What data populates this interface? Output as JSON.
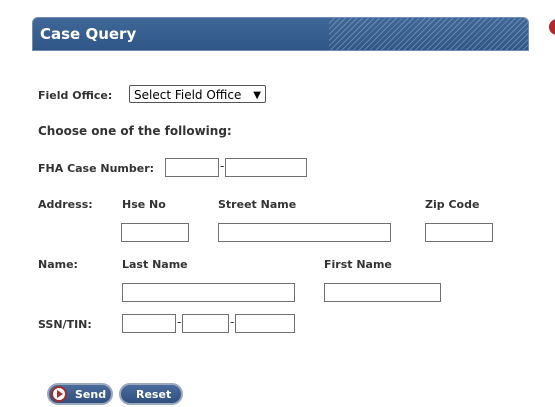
{
  "header": {
    "title": "Case Query"
  },
  "field_office": {
    "label": "Field Office:",
    "selected": "Select Field Office"
  },
  "choose_heading": "Choose one of the following:",
  "fha": {
    "label": "FHA Case Number:"
  },
  "address": {
    "label": "Address:",
    "hse_no": "Hse No",
    "street_name": "Street Name",
    "zip_code": "Zip Code"
  },
  "name": {
    "label": "Name:",
    "last_name": "Last Name",
    "first_name": "First Name"
  },
  "ssn": {
    "label": "SSN/TIN:"
  },
  "separator": "-",
  "buttons": {
    "send": "Send",
    "reset": "Reset"
  },
  "colors": {
    "title_bar": "#3f6797",
    "button": "#3c5e8e",
    "send_icon": "#a32c2c"
  }
}
